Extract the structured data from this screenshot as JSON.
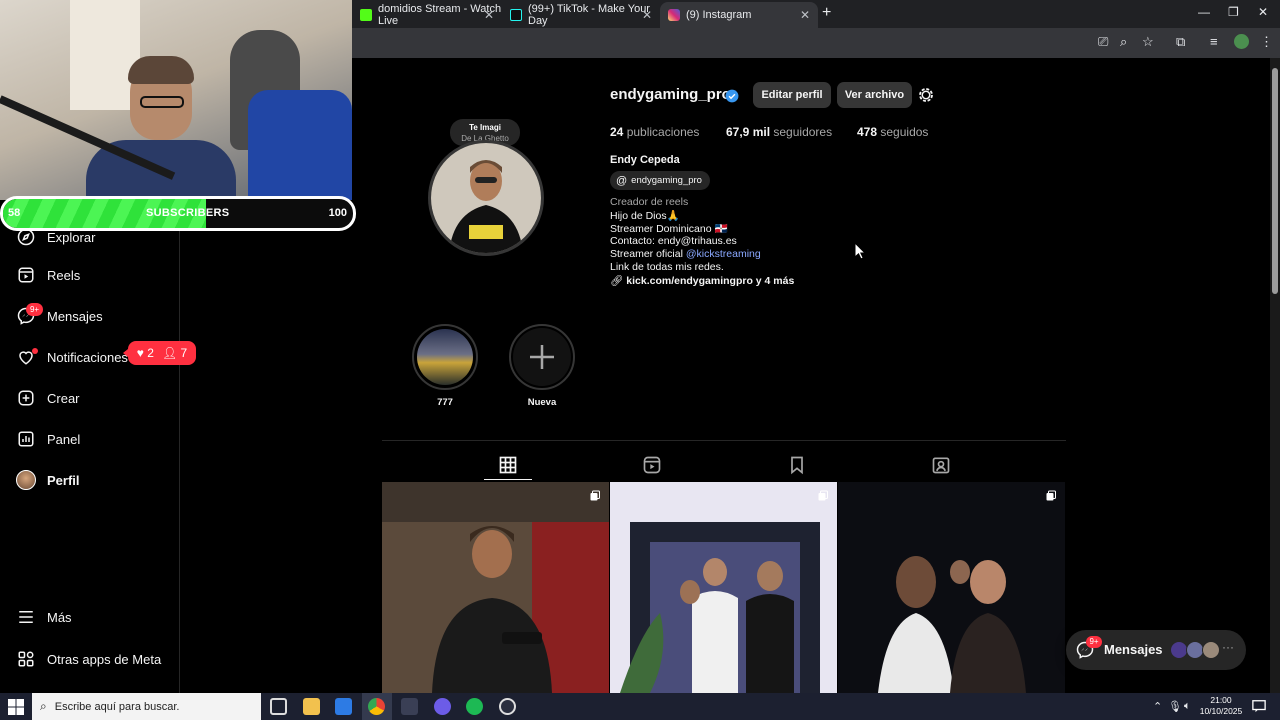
{
  "browser": {
    "tabs": [
      {
        "title": "domidios Stream - Watch Live"
      },
      {
        "title": "(99+) TikTok - Make Your Day"
      },
      {
        "title": "(9) Instagram"
      }
    ],
    "new_tab": "+",
    "window_controls": {
      "minimize": "—",
      "maximize": "❐",
      "close": "✕"
    }
  },
  "overlay": {
    "subscriber_goal": {
      "current": "58",
      "label": "SUBSCRIBERS",
      "target": "100",
      "progress": 0.58
    }
  },
  "sidebar": {
    "items": [
      {
        "label": "Explorar",
        "icon": "compass-icon"
      },
      {
        "label": "Reels",
        "icon": "reels-icon"
      },
      {
        "label": "Mensajes",
        "icon": "messenger-icon",
        "badge": "9+"
      },
      {
        "label": "Notificaciones",
        "icon": "heart-icon"
      },
      {
        "label": "Crear",
        "icon": "plus-square-icon"
      },
      {
        "label": "Panel",
        "icon": "dashboard-icon"
      },
      {
        "label": "Perfil",
        "icon": "avatar"
      }
    ],
    "notifications_popup": {
      "likes": "2",
      "follows": "7"
    },
    "footer": [
      {
        "label": "Más",
        "icon": "menu-icon"
      },
      {
        "label": "Otras apps de Meta",
        "icon": "meta-apps-icon"
      }
    ]
  },
  "profile": {
    "username": "endygaming_pro",
    "buttons": {
      "edit": "Editar perfil",
      "archive": "Ver archivo"
    },
    "stats": {
      "posts_count": "24",
      "posts_label": "publicaciones",
      "followers_count": "67,9 mil",
      "followers_label": "seguidores",
      "following_count": "478",
      "following_label": "seguidos"
    },
    "full_name": "Endy Cepeda",
    "threads_handle": "endygaming_pro",
    "category": "Creador de reels",
    "bio_lines": {
      "line1": "Hijo de Dios🙏",
      "line2": "Streamer Dominicano 🇩🇴",
      "line3": "Contacto: endy@trihaus.es",
      "line4_prefix": "Streamer oficial ",
      "line4_mention": "@kickstreaming",
      "line5": "Link de todas mis redes."
    },
    "link": "kick.com/endygamingpro y 4 más",
    "note": {
      "title": "Te Imagi",
      "subtitle": "De La Ghetto"
    },
    "highlights": [
      {
        "label": "777"
      },
      {
        "label": "Nueva"
      }
    ]
  },
  "floating_messages": {
    "label": "Mensajes",
    "badge": "9+"
  },
  "taskbar": {
    "search_placeholder": "Escribe aquí para buscar.",
    "time": "21:00",
    "date": "10/10/2025"
  },
  "colors": {
    "instagram_red": "#ff3040",
    "verified_blue": "#3897f0",
    "subscriber_green": "#2fe23a",
    "background": "#000000"
  }
}
